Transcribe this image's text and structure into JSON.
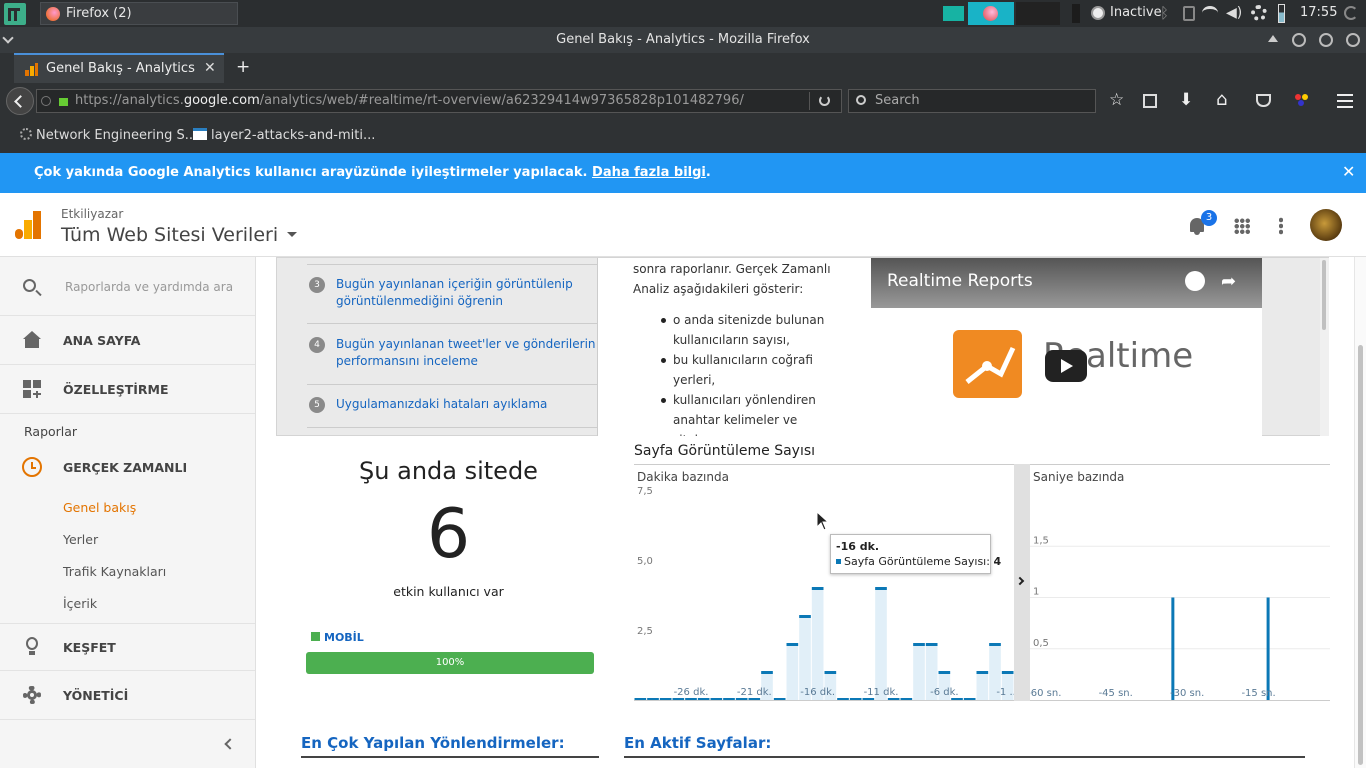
{
  "system_bar": {
    "taskbar_item": "Firefox (2)",
    "tray_status": "Inactive",
    "clock": "17:55"
  },
  "window": {
    "title": "Genel Bakış - Analytics - Mozilla Firefox"
  },
  "browser": {
    "tab_title": "Genel Bakış - Analytics",
    "url_prefix": "https://analytics.",
    "url_domain": "google.com",
    "url_suffix": "/analytics/web/#realtime/rt-overview/a62329414w97365828p101482796/",
    "search_placeholder": "Search",
    "bookmarks": [
      "Network Engineering S...",
      "layer2-attacks-and-miti..."
    ]
  },
  "banner": {
    "text": "Çok yakında Google Analytics kullanıcı arayüzünde iyileştirmeler yapılacak.",
    "link": "Daha fazla bilgi",
    "end": "."
  },
  "ga_header": {
    "account": "Etkiliyazar",
    "property": "Tüm Web Sitesi Verileri",
    "notification_count": "3"
  },
  "sidebar": {
    "search_placeholder": "Raporlarda ve yardımda ara",
    "home": "ANA SAYFA",
    "customization": "ÖZELLEŞTİRME",
    "reports_header": "Raporlar",
    "realtime": "GERÇEK ZAMANLI",
    "realtime_items": [
      "Genel bakış",
      "Yerler",
      "Trafik Kaynakları",
      "İçerik"
    ],
    "discover": "KEŞFET",
    "admin": "YÖNETİCİ"
  },
  "guide": {
    "items": [
      {
        "num": "3",
        "text": "Bugün yayınlanan içeriğin görüntülenip görüntülenmediğini öğrenin"
      },
      {
        "num": "4",
        "text": "Bugün yayınlanan tweet'ler ve gönderilerin performansını inceleme"
      },
      {
        "num": "5",
        "text": "Uygulamanızdaki hataları ayıklama"
      }
    ],
    "intro": "sonra raporlanır. Gerçek Zamanlı Analiz aşağıdakileri gösterir:",
    "bullets": [
      "o anda sitenizde bulunan kullanıcıların sayısı,",
      "bu kullanıcıların coğrafi yerleri,",
      "kullanıcıları yönlendiren anahtar kelimeler ve siteler,"
    ],
    "video_title": "Realtime Reports",
    "video_brand": "Realtime"
  },
  "active_users": {
    "title": "Şu anda sitede",
    "count": "6",
    "subtitle": "etkin kullanıcı var",
    "device_label": "MOBİL",
    "device_percent": "100%",
    "device_fraction": 1.0,
    "color": "#4caf50"
  },
  "pageviews": {
    "title": "Sayfa Görüntüleme Sayısı",
    "per_minute_label": "Dakika bazında",
    "per_second_label": "Saniye bazında",
    "tooltip_time": "-16 dk.",
    "tooltip_series": "Sayfa Görüntüleme Sayısı:",
    "tooltip_value": "4"
  },
  "chart_data": [
    {
      "type": "bar",
      "title": "Dakika bazında",
      "ylim": [
        0,
        7.5
      ],
      "yticks": [
        "2,5",
        "5,0",
        "7,5"
      ],
      "xticks": [
        "-26 dk.",
        "-21 dk.",
        "-16 dk.",
        "-11 dk.",
        "-6 dk.",
        "-1 ..."
      ],
      "x": [
        -30,
        -29,
        -28,
        -27,
        -26,
        -25,
        -24,
        -23,
        -22,
        -21,
        -20,
        -19,
        -18,
        -17,
        -16,
        -15,
        -14,
        -13,
        -12,
        -11,
        -10,
        -9,
        -8,
        -7,
        -6,
        -5,
        -4,
        -3,
        -2,
        -1
      ],
      "values": [
        0,
        0,
        0,
        0,
        0,
        0,
        0,
        0,
        0,
        0,
        1,
        0,
        2,
        3,
        4,
        1,
        0,
        0,
        0,
        4,
        0,
        0,
        2,
        2,
        1,
        0,
        0,
        1,
        2,
        1
      ],
      "color": "#0b78b6"
    },
    {
      "type": "bar",
      "title": "Saniye bazında",
      "ylim": [
        0,
        2
      ],
      "yticks": [
        "0,5",
        "1",
        "1,5"
      ],
      "xticks": [
        "-60 sn.",
        "-45 sn.",
        "-30 sn.",
        "-15 sn."
      ],
      "x": [
        -33,
        -13
      ],
      "values": [
        1,
        1
      ],
      "color": "#0b78b6"
    }
  ],
  "sections": {
    "top_referrals": "En Çok Yapılan Yönlendirmeler:",
    "top_pages": "En Aktif Sayfalar:"
  }
}
